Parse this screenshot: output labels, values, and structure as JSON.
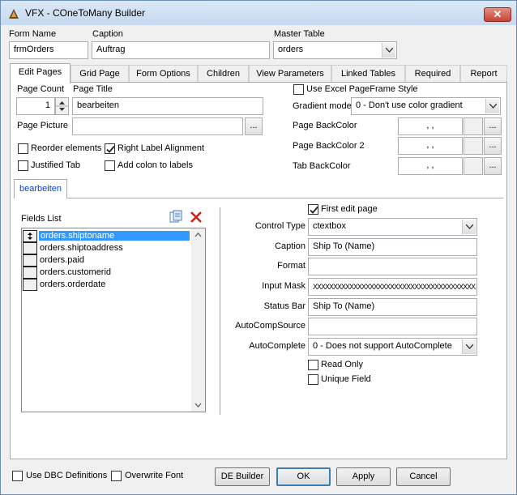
{
  "window": {
    "title": "VFX - COneToMany Builder",
    "close_glyph": "✕"
  },
  "header": {
    "form_name_label": "Form Name",
    "form_name_value": "frmOrders",
    "caption_label": "Caption",
    "caption_value": "Auftrag",
    "master_table_label": "Master Table",
    "master_table_value": "orders"
  },
  "tabs": [
    {
      "label": "Edit Pages",
      "active": true
    },
    {
      "label": "Grid Page"
    },
    {
      "label": "Form Options"
    },
    {
      "label": "Children"
    },
    {
      "label": "View Parameters"
    },
    {
      "label": "Linked Tables"
    },
    {
      "label": "Required"
    },
    {
      "label": "Report"
    }
  ],
  "edit_pages": {
    "page_count_label": "Page Count",
    "page_count_value": "1",
    "page_title_label": "Page Title",
    "page_title_value": "bearbeiten",
    "page_picture_label": "Page Picture",
    "page_picture_value": "",
    "browse_label": "...",
    "use_excel_label": "Use Excel PageFrame Style",
    "use_excel_checked": false,
    "gradient_mode_label": "Gradient mode",
    "gradient_mode_value": "0 - Don't use color gradient",
    "page_backcolor_label": "Page BackColor",
    "page_backcolor_value": ", ,",
    "page_backcolor2_label": "Page BackColor 2",
    "page_backcolor2_value": ", ,",
    "tab_backcolor_label": "Tab BackColor",
    "tab_backcolor_value": ", ,",
    "reorder_label": "Reorder elements",
    "reorder_checked": false,
    "right_label_label": "Right Label Alignment",
    "right_label_checked": true,
    "justified_label": "Justified Tab",
    "justified_checked": false,
    "add_colon_label": "Add colon to labels",
    "add_colon_checked": false
  },
  "inner_tab": {
    "label": "bearbeiten"
  },
  "fields": {
    "label": "Fields List",
    "items": [
      "orders.shiptoname",
      "orders.shiptoaddress",
      "orders.paid",
      "orders.customerid",
      "orders.orderdate"
    ],
    "selected_index": 0
  },
  "props": {
    "first_edit_label": "First edit page",
    "first_edit_checked": true,
    "control_type_label": "Control Type",
    "control_type_value": "ctextbox",
    "caption_label": "Caption",
    "caption_value": "Ship To (Name)",
    "format_label": "Format",
    "format_value": "",
    "input_mask_label": "Input Mask",
    "input_mask_value": "XXXXXXXXXXXXXXXXXXXXXXXXXXXXXXXXXXXXXXXX",
    "status_bar_label": "Status Bar",
    "status_bar_value": "Ship To (Name)",
    "autocompsource_label": "AutoCompSource",
    "autocompsource_value": "",
    "autocomplete_label": "AutoComplete",
    "autocomplete_value": "0 - Does not support AutoComplete",
    "read_only_label": "Read Only",
    "read_only_checked": false,
    "unique_label": "Unique Field",
    "unique_checked": false
  },
  "footer": {
    "use_dbc_label": "Use DBC Definitions",
    "use_dbc_checked": false,
    "overwrite_font_label": "Overwrite Font",
    "overwrite_font_checked": false,
    "de_builder_label": "DE Builder",
    "ok_label": "OK",
    "apply_label": "Apply",
    "cancel_label": "Cancel"
  }
}
